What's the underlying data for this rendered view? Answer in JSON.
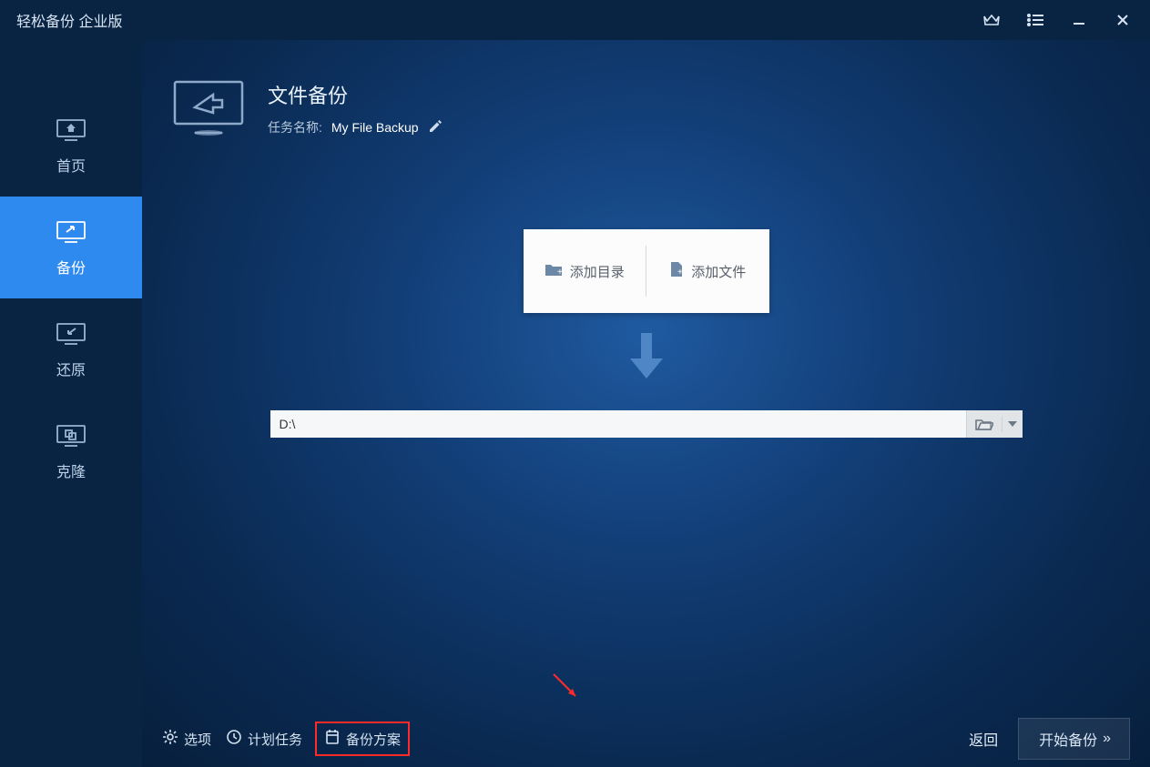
{
  "app": {
    "title": "轻松备份 企业版"
  },
  "sidebar": {
    "items": [
      {
        "label": "首页"
      },
      {
        "label": "备份"
      },
      {
        "label": "还原"
      },
      {
        "label": "克隆"
      }
    ]
  },
  "header": {
    "title": "文件备份",
    "task_name_label": "任务名称:",
    "task_name_value": "My File Backup"
  },
  "panel": {
    "add_dir": "添加目录",
    "add_file": "添加文件"
  },
  "destination": {
    "path": "D:\\"
  },
  "footer": {
    "options": "选项",
    "schedule": "计划任务",
    "scheme": "备份方案",
    "back": "返回",
    "start": "开始备份"
  }
}
